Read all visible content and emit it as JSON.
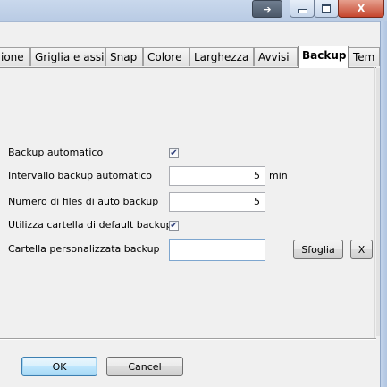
{
  "titlebar": {
    "buttons": {
      "restore_icon": "arrow-icon",
      "close_label": "X"
    }
  },
  "tabs": [
    {
      "label": "ione",
      "active": false
    },
    {
      "label": "Griglia e assi",
      "active": false
    },
    {
      "label": "Snap",
      "active": false
    },
    {
      "label": "Colore",
      "active": false
    },
    {
      "label": "Larghezza",
      "active": false
    },
    {
      "label": "Avvisi",
      "active": false
    },
    {
      "label": "Backup",
      "active": true
    },
    {
      "label": "Tem",
      "active": false
    }
  ],
  "form": {
    "auto_backup_label": "Backup automatico",
    "auto_backup_checked": true,
    "interval_label": "Intervallo backup automatico",
    "interval_value": "5",
    "interval_unit": "min",
    "num_files_label": "Numero di files di auto backup",
    "num_files_value": "5",
    "default_folder_label": "Utilizza cartella di default backup",
    "default_folder_checked": true,
    "custom_folder_label": "Cartella personalizzata backup",
    "custom_folder_value": "",
    "browse_label": "Sfoglia",
    "clear_label": "X"
  },
  "footer": {
    "ok_label": "OK",
    "cancel_label": "Cancel"
  }
}
